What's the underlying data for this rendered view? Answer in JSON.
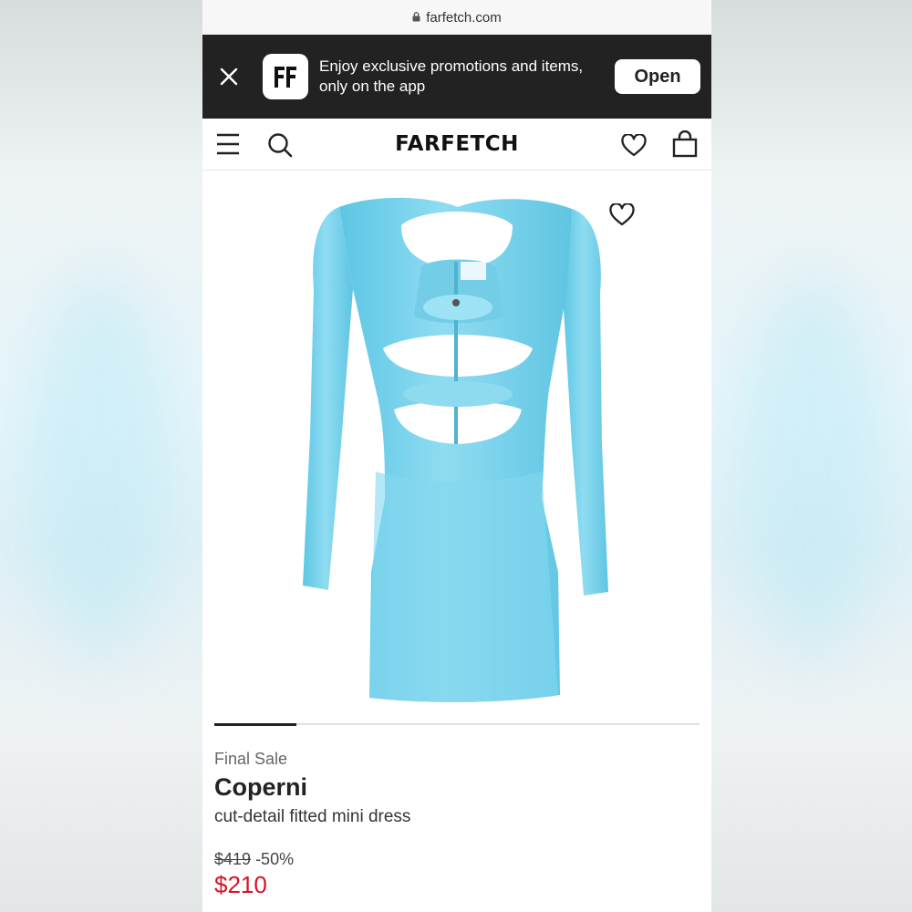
{
  "browser": {
    "url": "farfetch.com"
  },
  "app_banner": {
    "app_icon_text": "FF",
    "text_line1": "Enjoy exclusive promotions and items,",
    "text_line2": "only on the app",
    "open_label": "Open"
  },
  "header": {
    "brand": "FARFETCH"
  },
  "product": {
    "image_progress": 0.17,
    "label": "Final Sale",
    "designer": "Coperni",
    "name": "cut-detail fitted mini dress",
    "original_price": "$419",
    "discount": "-50%",
    "sale_price": "$210"
  },
  "colors": {
    "banner_bg": "#222222",
    "sale_price": "#d7131e",
    "dress": "#7fd6ef"
  },
  "icons": [
    "lock-icon",
    "close-icon",
    "menu-icon",
    "search-icon",
    "heart-icon",
    "shopping-bag-icon"
  ]
}
